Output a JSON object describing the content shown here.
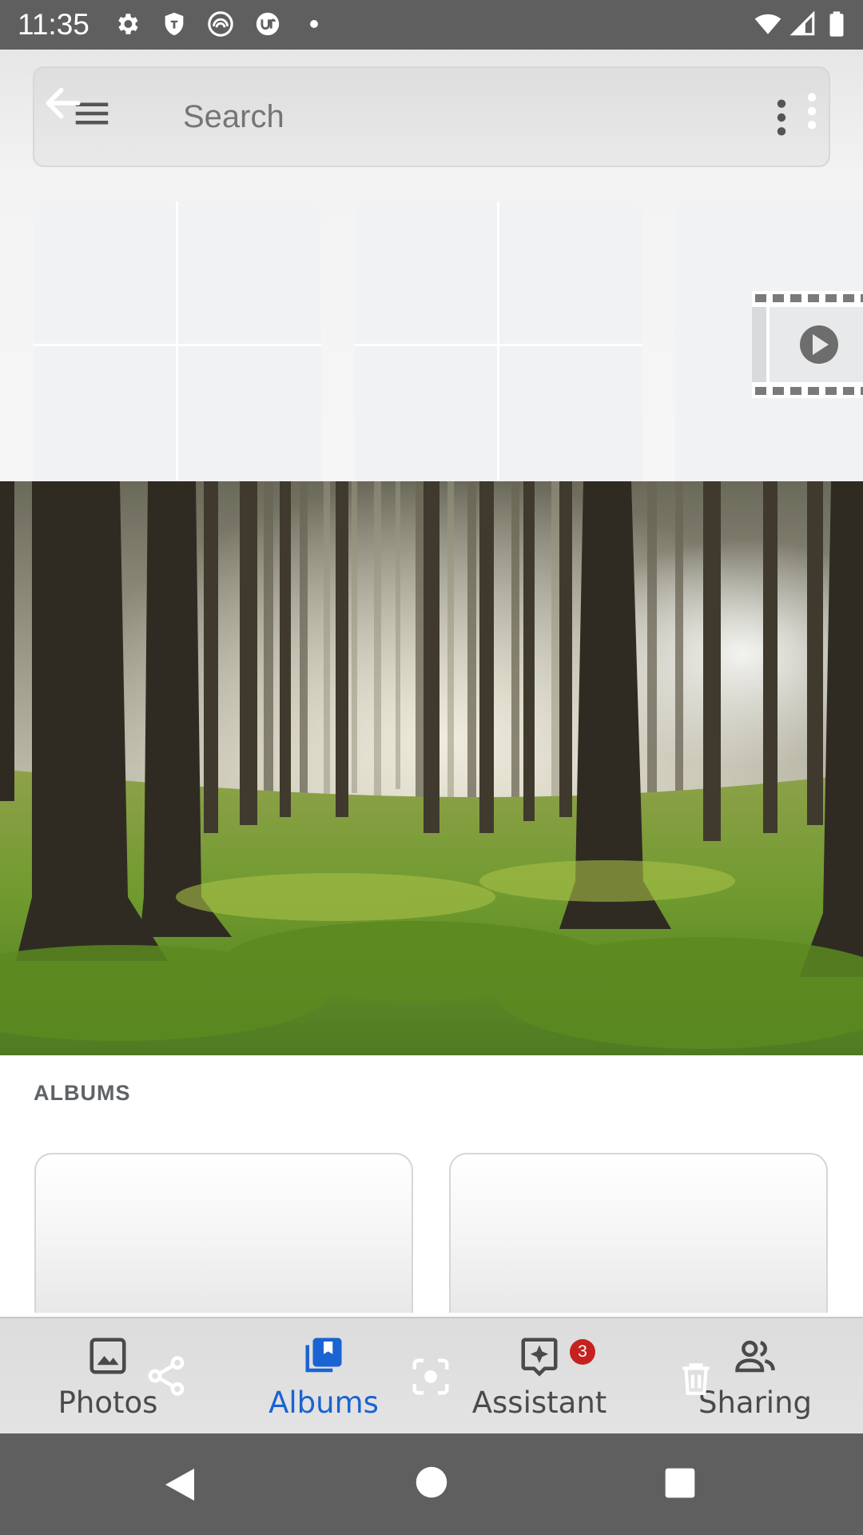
{
  "status_bar": {
    "time": "11:35",
    "left_icons": [
      "settings-icon",
      "shield-icon",
      "app-icon",
      "app-icon",
      "dot-icon"
    ],
    "right_icons": [
      "wifi-icon",
      "signal-icon",
      "battery-icon"
    ]
  },
  "search": {
    "placeholder": "Search"
  },
  "albums_section": {
    "heading": "ALBUMS"
  },
  "bottom_nav": {
    "items": [
      {
        "label": "Photos",
        "icon": "photo-icon"
      },
      {
        "label": "Albums",
        "icon": "albums-icon"
      },
      {
        "label": "Assistant",
        "icon": "assistant-icon",
        "badge": "3"
      },
      {
        "label": "Sharing",
        "icon": "people-icon"
      }
    ],
    "active_index": 1
  },
  "colors": {
    "accent": "#1a63d2",
    "badge": "#c5221f"
  }
}
